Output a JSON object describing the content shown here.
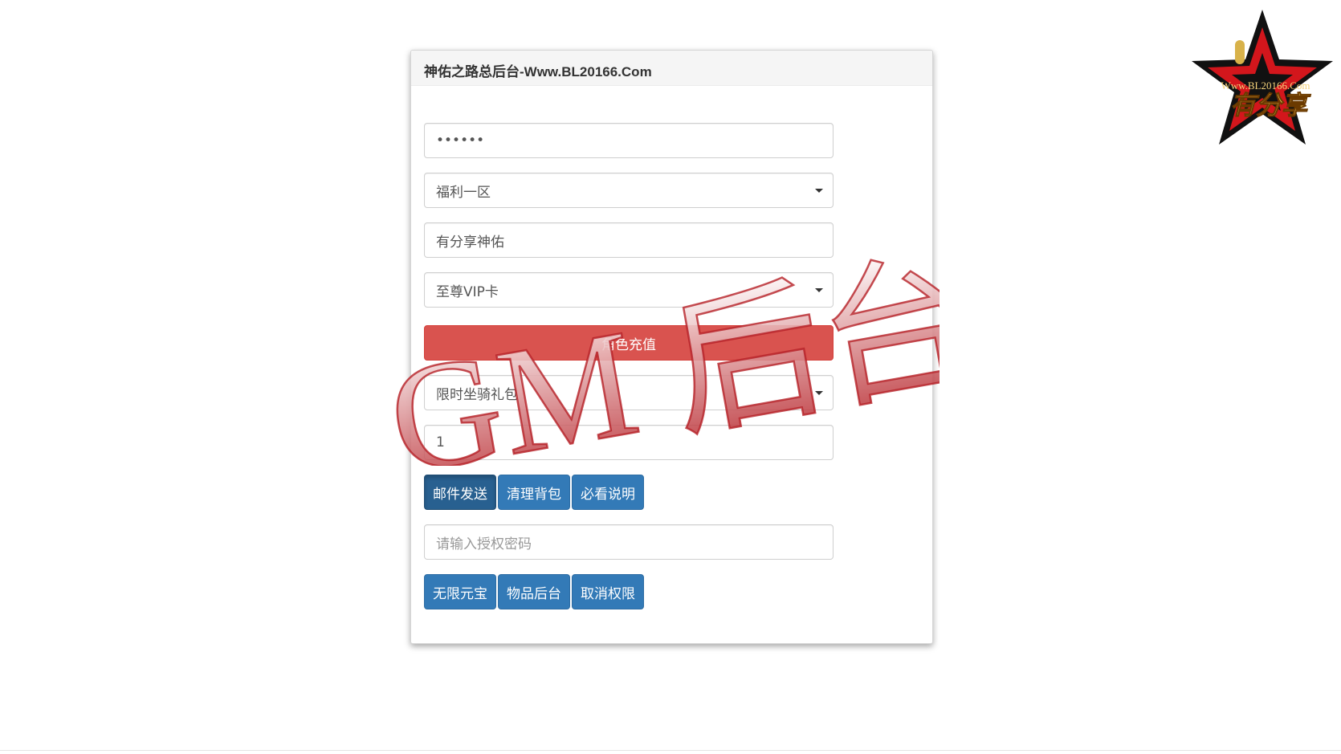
{
  "panel": {
    "title": "神佑之路总后台-Www.BL20166.Com"
  },
  "form": {
    "password_value": "••••••",
    "server_select": "福利一区",
    "role_name_value": "有分享神佑",
    "card_select": "至尊VIP卡",
    "recharge_button": "角色充值",
    "item_select": "限时坐骑礼包",
    "quantity_value": "1",
    "mail_button": "邮件发送",
    "clear_bag_button": "清理背包",
    "readme_button": "必看说明",
    "auth_password_placeholder": "请输入授权密码",
    "unlimited_yuanbao_button": "无限元宝",
    "item_backend_button": "物品后台",
    "revoke_permission_button": "取消权限"
  },
  "watermark": {
    "text": "GM 后台",
    "color": "#c0282d"
  },
  "logo": {
    "site": "Www.BL20166.Com",
    "brand": "有分享"
  },
  "colors": {
    "primary": "#337ab7",
    "danger": "#d9534f"
  }
}
